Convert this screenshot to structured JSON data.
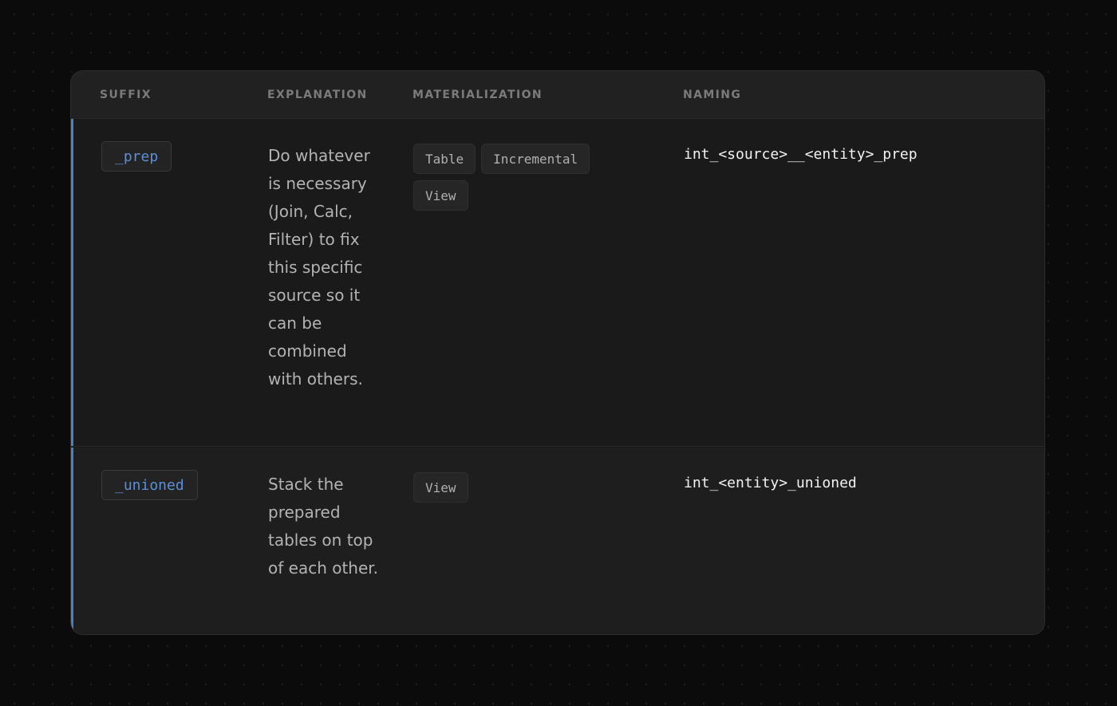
{
  "table": {
    "headers": {
      "suffix": "SUFFIX",
      "explanation": "EXPLANATION",
      "materialization": "MATERIALIZATION",
      "naming": "NAMING"
    },
    "rows": [
      {
        "suffix": "_prep",
        "explanation": "Do whatever is necessary (Join, Calc, Filter) to fix this specific source so it can be combined with others.",
        "materialization": [
          "Table",
          "Incremental",
          "View"
        ],
        "naming": "int_<source>__<entity>_prep"
      },
      {
        "suffix": "_unioned",
        "explanation": "Stack the prepared tables on top of each other.",
        "materialization": [
          "View"
        ],
        "naming": "int_<entity>_unioned"
      }
    ]
  },
  "colors": {
    "accent": "#4a7fc4",
    "suffix_text": "#5b8fd6",
    "background": "#0b0b0b",
    "card": "#1a1a1a"
  }
}
